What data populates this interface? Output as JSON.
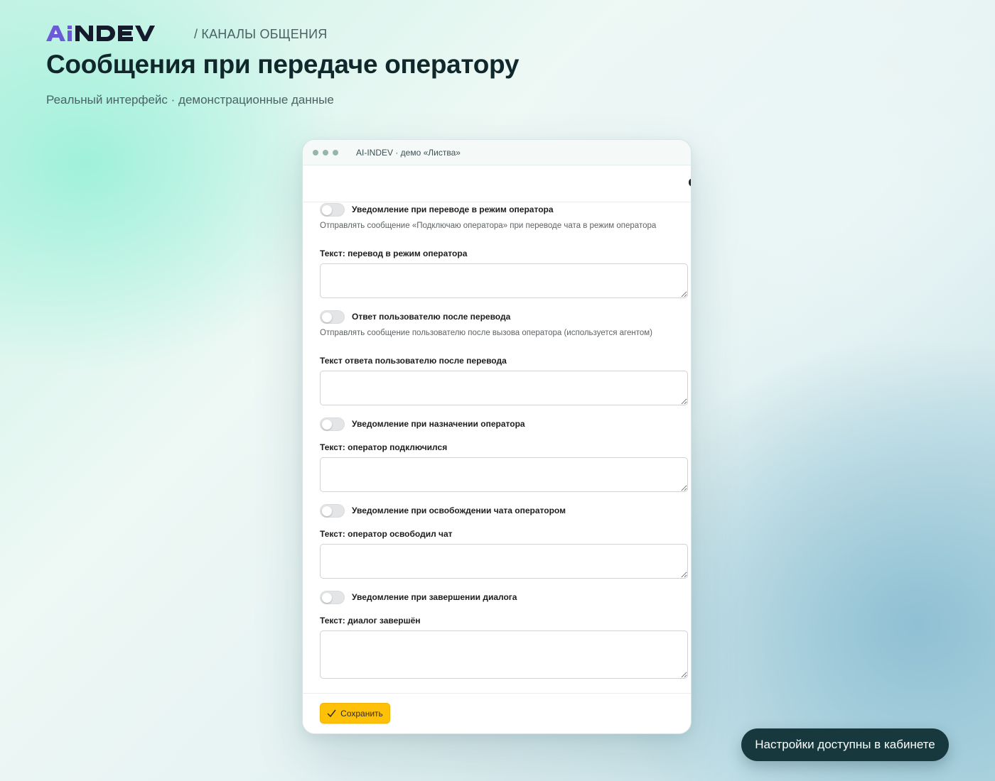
{
  "header": {
    "logo_text": "AiNDEV",
    "breadcrumb": "/ КАНАЛЫ ОБЩЕНИЯ",
    "title": "Сообщения при передаче оператору",
    "subtitle": "Реальный интерфейс · демонстрационные данные"
  },
  "window": {
    "title": "AI-INDEV · демо «Листва»"
  },
  "settings": [
    {
      "toggle_label": "Уведомление при переводе в режим оператора",
      "toggle_on": false,
      "description": "Отправлять сообщение «Подключаю оператора» при переводе чата в режим оператора",
      "field_label": "Текст: перевод в режим оператора",
      "field_value": ""
    },
    {
      "toggle_label": "Ответ пользователю после перевода",
      "toggle_on": false,
      "description": "Отправлять сообщение пользователю после вызова оператора (используется агентом)",
      "field_label": "Текст ответа пользователю после перевода",
      "field_value": ""
    },
    {
      "toggle_label": "Уведомление при назначении оператора",
      "toggle_on": false,
      "field_label": "Текст: оператор подключился",
      "field_value": ""
    },
    {
      "toggle_label": "Уведомление при освобождении чата оператором",
      "toggle_on": false,
      "field_label": "Текст: оператор освободил чат",
      "field_value": ""
    },
    {
      "toggle_label": "Уведомление при завершении диалога",
      "toggle_on": false,
      "field_label": "Текст: диалог завершён",
      "field_value": ""
    }
  ],
  "footer": {
    "save_label": "Сохранить"
  },
  "cta": {
    "label": "Настройки доступны в кабинете"
  },
  "colors": {
    "brand_purple": "#6b5bd6",
    "brand_dark": "#151a2d",
    "save_button": "#ffc107",
    "cta_background": "#17393d"
  }
}
